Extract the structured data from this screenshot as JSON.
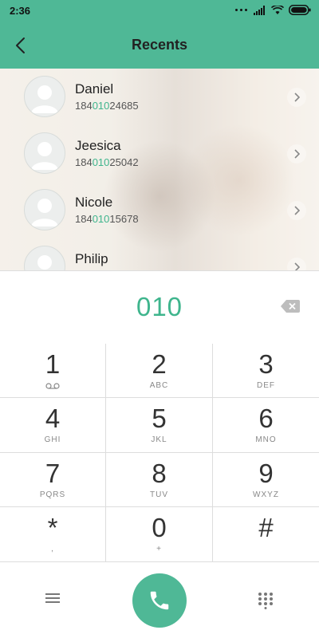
{
  "status_bar": {
    "time": "2:36"
  },
  "header": {
    "title": "Recents"
  },
  "contacts": [
    {
      "name": "Daniel",
      "number_prefix": "184",
      "number_match": "010",
      "number_suffix": "24685"
    },
    {
      "name": "Jeesica",
      "number_prefix": "184",
      "number_match": "010",
      "number_suffix": "25042"
    },
    {
      "name": "Nicole",
      "number_prefix": "184",
      "number_match": "010",
      "number_suffix": "15678"
    },
    {
      "name": "Philip"
    }
  ],
  "dialer": {
    "entered_number": "010"
  },
  "keys": [
    {
      "digit": "1",
      "letters": ""
    },
    {
      "digit": "2",
      "letters": "ABC"
    },
    {
      "digit": "3",
      "letters": "DEF"
    },
    {
      "digit": "4",
      "letters": "GHI"
    },
    {
      "digit": "5",
      "letters": "JKL"
    },
    {
      "digit": "6",
      "letters": "MNO"
    },
    {
      "digit": "7",
      "letters": "PQRS"
    },
    {
      "digit": "8",
      "letters": "TUV"
    },
    {
      "digit": "9",
      "letters": "WXYZ"
    },
    {
      "digit": "*",
      "letters": ","
    },
    {
      "digit": "0",
      "letters": "+"
    },
    {
      "digit": "#",
      "letters": ""
    }
  ],
  "icons": {
    "voicemail": "voicemail-icon",
    "back": "back-arrow-icon",
    "backspace": "backspace-icon",
    "menu": "menu-icon",
    "call": "phone-icon",
    "dialpad": "dialpad-icon"
  },
  "colors": {
    "accent": "#4fb896",
    "highlight": "#3fb58d"
  }
}
